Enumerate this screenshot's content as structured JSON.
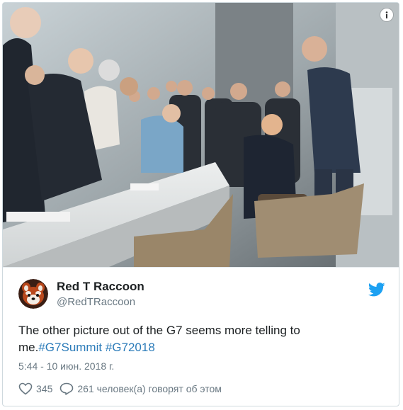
{
  "tweet": {
    "display_name": "Red T Raccoon",
    "handle": "@RedTRaccoon",
    "text_plain": "The other picture out of the G7 seems more telling to me.",
    "hashtags": [
      "#G7Summit",
      "#G72018"
    ],
    "timestamp": "5:44 - 10 июн. 2018 г.",
    "likes": "345",
    "replies_label": "261 человек(а) говорят об этом"
  },
  "icons": {
    "info": "info-icon",
    "bird": "twitter-bird-icon",
    "heart": "heart-icon",
    "reply": "speech-bubble-icon"
  },
  "colors": {
    "link": "#2b7bb9",
    "bird": "#1da1f2",
    "muted": "#697882",
    "text": "#1c2022"
  }
}
